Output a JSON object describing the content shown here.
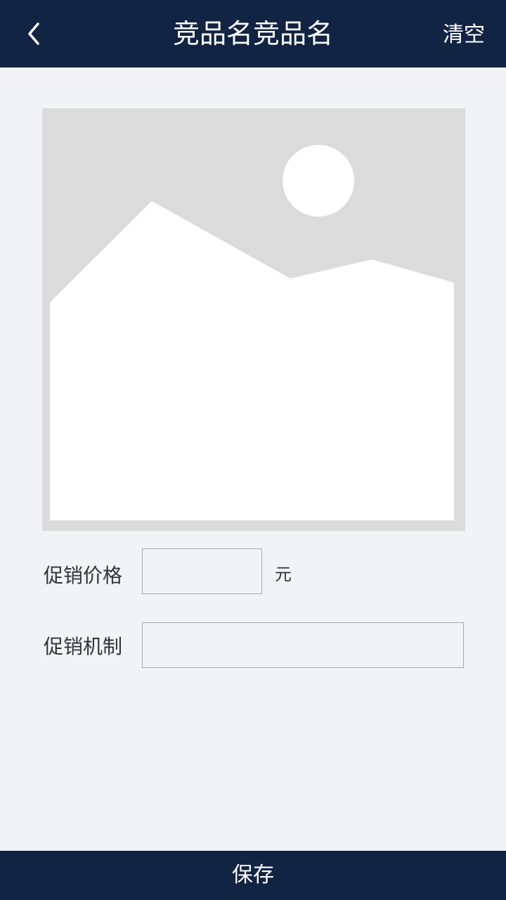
{
  "header": {
    "back_icon": "chevron-left-icon",
    "title": "竞品名竞品名",
    "clear_label": "清空"
  },
  "image_placeholder": {
    "icon": "image-placeholder-icon"
  },
  "form": {
    "price_label": "促销价格",
    "price_value": "",
    "price_unit": "元",
    "mechanism_label": "促销机制",
    "mechanism_value": ""
  },
  "footer": {
    "save_label": "保存"
  },
  "colors": {
    "header_bg": "#122443",
    "page_bg": "#f1f3f7",
    "placeholder_bg": "#dbdbdb"
  }
}
